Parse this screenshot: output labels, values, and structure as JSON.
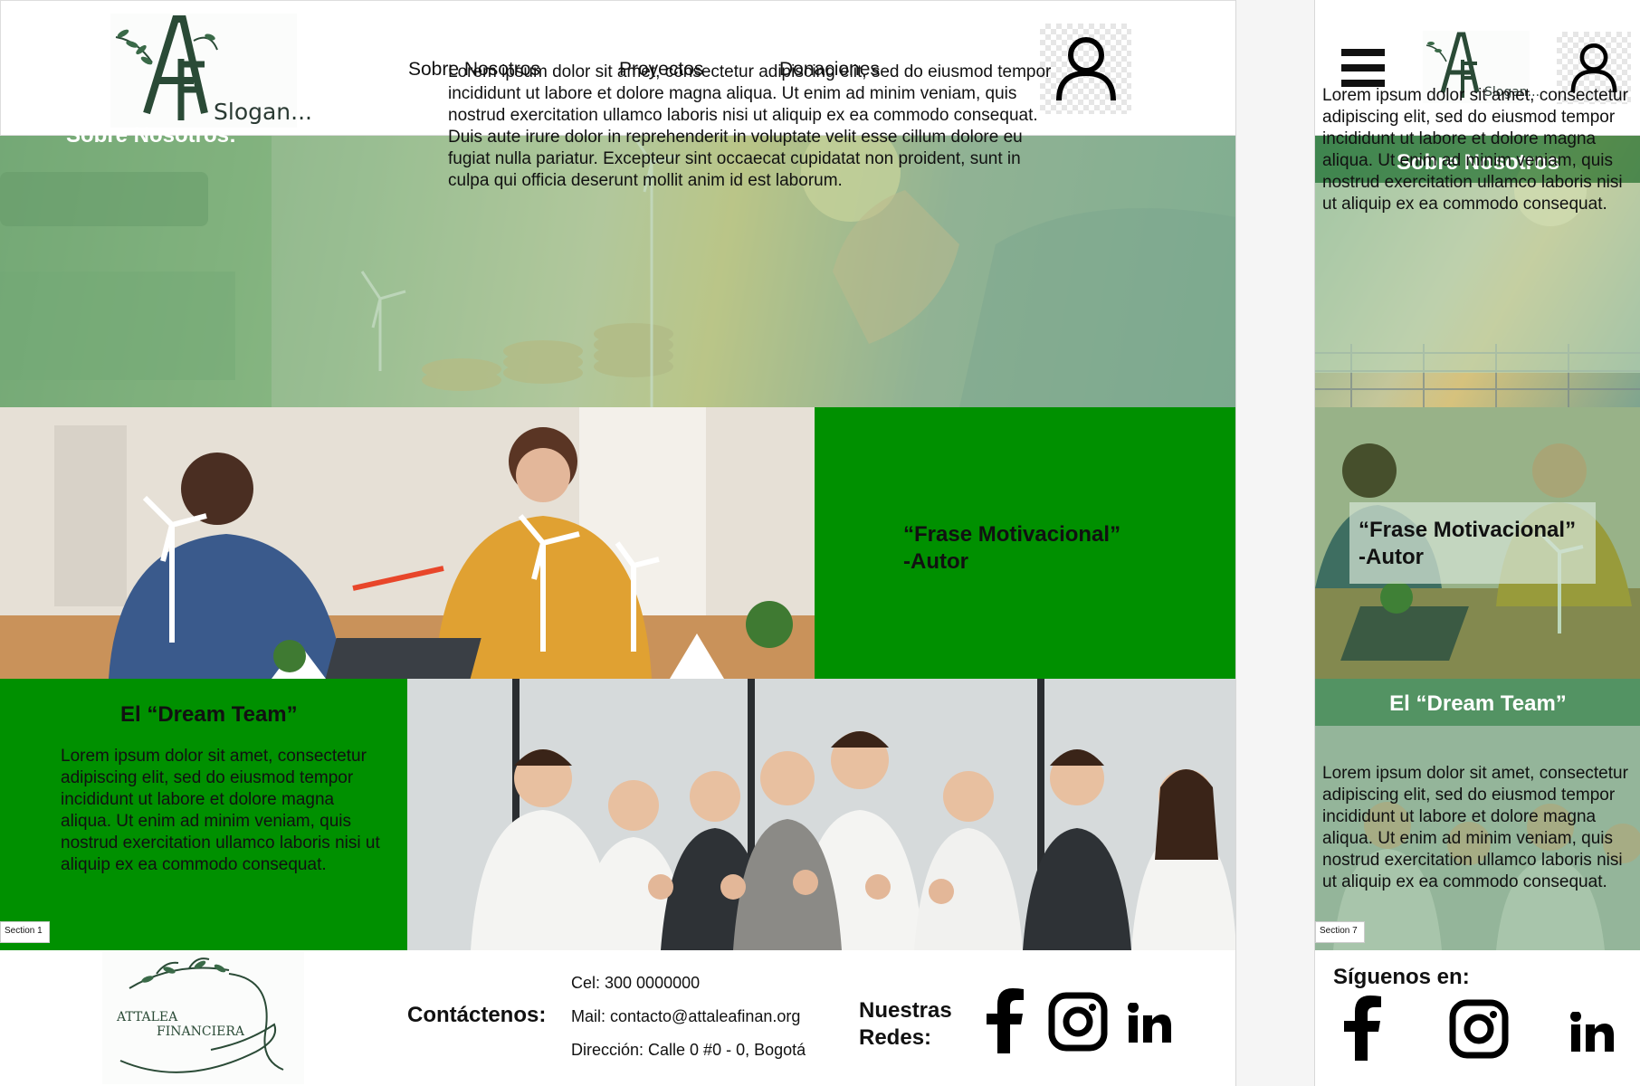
{
  "desktop": {
    "header": {
      "logo_letters": "AF",
      "slogan": "Slogan...",
      "nav": [
        "Sobre Nosotros",
        "Proyectos",
        "Donaciones"
      ]
    },
    "hero": {
      "title": "Sobre Nosotros:",
      "text": "Lorem ipsum dolor sit amet, consectetur adipiscing elit, sed do eiusmod tempor incididunt ut labore et dolore magna aliqua. Ut enim ad minim veniam, quis nostrud exercitation ullamco laboris nisi ut aliquip ex ea commodo consequat. Duis aute irure dolor in reprehenderit in voluptate velit esse cillum dolore eu fugiat nulla pariatur. Excepteur sint occaecat cupidatat non proident, sunt in culpa qui officia deserunt mollit anim id est laborum."
    },
    "quote": {
      "line1": "“Frase Motivacional”",
      "line2": "-Autor"
    },
    "team": {
      "title": "El “Dream Team”",
      "text": "Lorem ipsum dolor sit amet, consectetur adipiscing elit, sed do eiusmod tempor incididunt ut labore et dolore magna aliqua. Ut enim ad minim veniam, quis nostrud exercitation ullamco laboris nisi ut aliquip ex ea commodo consequat."
    },
    "section_tag": "Section 1",
    "footer": {
      "brand_line1": "ATTALEA",
      "brand_line2": "FINANCIERA",
      "contact_heading": "Contáctenos:",
      "phone": "Cel: 300 0000000",
      "mail": "Mail: contacto@attaleafinan.org",
      "address": "Dirección: Calle 0 #0 - 0, Bogotá",
      "social_heading_1": "Nuestras",
      "social_heading_2": "Redes:"
    }
  },
  "mobile": {
    "header": {
      "slogan": "Slogan..."
    },
    "section1_title": "Sobre Nosotros",
    "section1_text": "Lorem ipsum dolor sit amet, consectetur adipiscing elit, sed do eiusmod tempor incididunt ut labore et dolore magna aliqua. Ut enim ad minim veniam, quis nostrud exercitation ullamco laboris nisi ut aliquip ex ea commodo consequat.",
    "quote": {
      "line1": "“Frase Motivacional”",
      "line2": "-Autor"
    },
    "team_title": "El “Dream Team”",
    "team_text": "Lorem ipsum dolor sit amet, consectetur adipiscing elit, sed do eiusmod tempor incididunt ut labore et dolore magna aliqua. Ut enim ad minim veniam, quis nostrud exercitation ullamco laboris nisi ut aliquip ex ea commodo consequat.",
    "section_tag": "Section 7",
    "follow_heading": "Síguenos en:"
  },
  "icons": [
    "user-icon",
    "hamburger-menu-icon",
    "facebook-icon",
    "instagram-icon",
    "linkedin-icon"
  ],
  "colors": {
    "green_panel": "#009000",
    "header_bg": "#ffffff",
    "text": "#111111",
    "logo_green": "#2a4a36"
  }
}
